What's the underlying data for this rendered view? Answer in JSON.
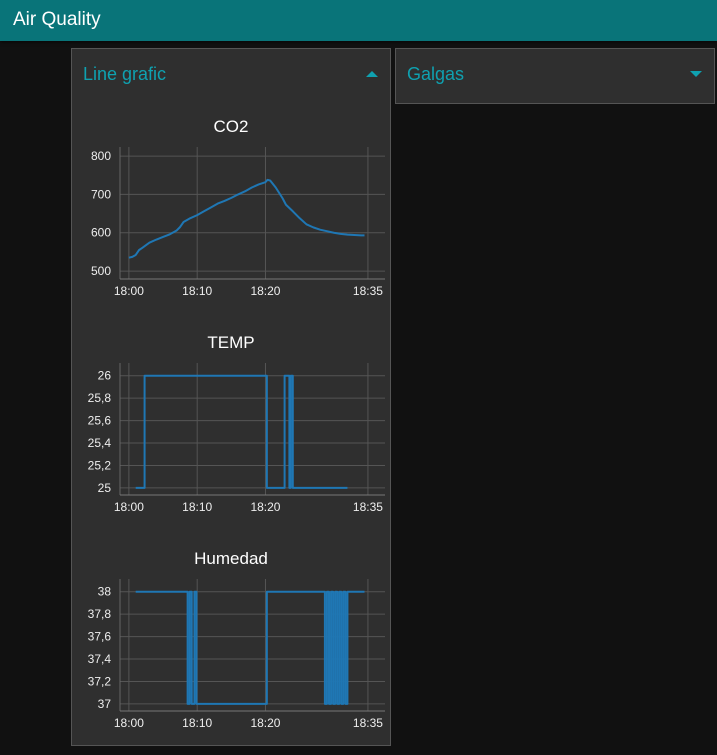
{
  "app": {
    "title": "Air Quality"
  },
  "groups": [
    {
      "title": "Line grafic",
      "expanded": true
    },
    {
      "title": "Galgas",
      "expanded": false
    }
  ],
  "colors": {
    "header": "#097479",
    "accent": "#0fa1b0",
    "line": "#1f77b4",
    "panel": "#2f2f2f",
    "background": "#111111"
  },
  "icons": {
    "collapse": "caret-up-icon",
    "expand": "caret-down-icon"
  },
  "chart_data": [
    {
      "type": "line",
      "title": "CO2",
      "xlabel": "",
      "ylabel": "",
      "x_ticks": [
        "18:00",
        "18:10",
        "18:20",
        "18:35"
      ],
      "x_tick_minutes": [
        0,
        10,
        20,
        35
      ],
      "xlim_minutes": [
        -1.3,
        37.5
      ],
      "y_ticks": [
        "800",
        "700",
        "600",
        "500"
      ],
      "ylim": [
        495,
        808
      ],
      "grid": true,
      "step": false,
      "series": [
        {
          "x": [
            0.0,
            0.5,
            1.0,
            1.5,
            2.0,
            3.0,
            4.0,
            5.0,
            6.0,
            6.5,
            7.0,
            7.5,
            8.0,
            9.0,
            10.0,
            11.0,
            12.0,
            13.0,
            14.0,
            15.0,
            16.0,
            17.0,
            18.0,
            19.0,
            19.5,
            20.0,
            20.3,
            20.7,
            21.5,
            22.5,
            23.0,
            24.0,
            25.0,
            26.0,
            27.0,
            28.0,
            29.0,
            30.0,
            31.0,
            32.0,
            33.0,
            34.0,
            34.5
          ],
          "y": [
            535,
            537,
            542,
            555,
            561,
            574,
            582,
            589,
            596,
            601,
            606,
            615,
            628,
            638,
            646,
            656,
            666,
            676,
            683,
            691,
            700,
            708,
            718,
            726,
            729,
            732,
            738,
            736,
            718,
            690,
            673,
            656,
            638,
            622,
            614,
            608,
            604,
            600,
            597,
            595,
            594,
            593,
            593
          ]
        }
      ]
    },
    {
      "type": "line",
      "title": "TEMP",
      "xlabel": "",
      "ylabel": "",
      "x_ticks": [
        "18:00",
        "18:10",
        "18:20",
        "18:35"
      ],
      "x_tick_minutes": [
        0,
        10,
        20,
        35
      ],
      "xlim_minutes": [
        -1.3,
        37.5
      ],
      "y_ticks": [
        "26",
        "25,8",
        "25,6",
        "25,4",
        "25,2",
        "25"
      ],
      "ylim": [
        24.99,
        26.06
      ],
      "grid": true,
      "step": true,
      "series": [
        {
          "x": [
            1.0,
            2.3,
            20.2,
            22.8,
            23.5,
            23.7,
            24.0,
            30.4,
            32.0
          ],
          "y": [
            25,
            26,
            25,
            26,
            25,
            26,
            25,
            25,
            25
          ],
          "x_full": [
            1.0,
            2.3,
            20.2,
            22.8,
            23.5,
            23.9,
            24.5,
            30.4,
            32.0
          ],
          "y_full": [
            25,
            26,
            25,
            26,
            25,
            26,
            25,
            25,
            25
          ]
        }
      ]
    },
    {
      "type": "line",
      "title": "Humedad",
      "xlabel": "",
      "ylabel": "",
      "x_ticks": [
        "18:00",
        "18:10",
        "18:20",
        "18:35"
      ],
      "x_tick_minutes": [
        0,
        10,
        20,
        35
      ],
      "xlim_minutes": [
        -1.3,
        37.5
      ],
      "y_ticks": [
        "38",
        "37,8",
        "37,6",
        "37,4",
        "37,2",
        "37"
      ],
      "ylim": [
        36.99,
        38.06
      ],
      "grid": true,
      "step": true,
      "series": [
        {
          "x": [
            1.0,
            8.6,
            8.9,
            9.2,
            9.6,
            9.9,
            20.2,
            28.7,
            29.0,
            29.3,
            29.6,
            29.9,
            30.2,
            30.5,
            30.8,
            31.1,
            31.4,
            31.7,
            32.0,
            32.3,
            34.5
          ],
          "y": [
            38,
            37,
            38,
            37,
            38,
            37,
            38,
            37,
            38,
            37,
            38,
            37,
            38,
            37,
            38,
            37,
            38,
            37,
            38,
            38,
            38
          ]
        }
      ]
    }
  ]
}
